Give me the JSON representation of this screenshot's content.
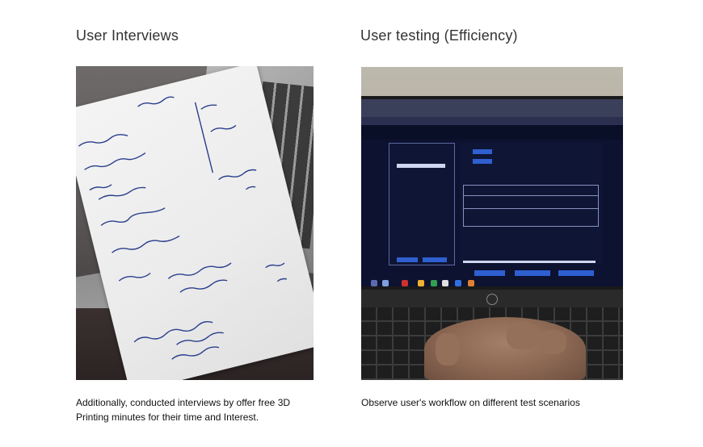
{
  "columns": [
    {
      "title": "User Interviews",
      "caption": "Additionally, conducted interviews by offer free 3D Printing minutes for their time and Interest."
    },
    {
      "title": "User testing (Efficiency)",
      "caption": "Observe user's workflow on different test scenarios"
    }
  ],
  "photos": {
    "left": {
      "subject": "handwritten-interview-notes"
    },
    "right": {
      "subject": "user-testing-laptop"
    }
  },
  "colors": {
    "ink": "#2a3f8c",
    "screen_bg": "#0d1230",
    "accent_blue": "#2f5fd0"
  }
}
